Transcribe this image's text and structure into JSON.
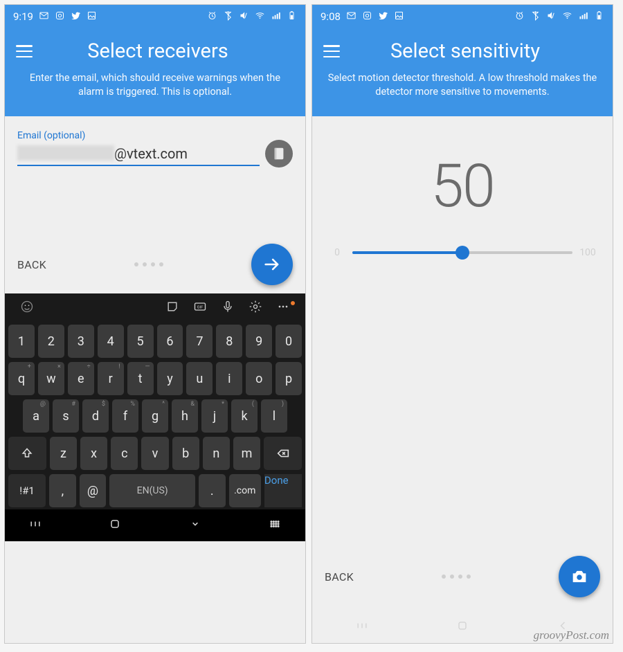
{
  "left": {
    "status": {
      "time": "9:19"
    },
    "header": {
      "title": "Select receivers",
      "subtitle": "Enter the email, which should receive warnings when the alarm is triggered. This is optional."
    },
    "email": {
      "label": "Email (optional)",
      "value_visible": "@vtext.com"
    },
    "actions": {
      "back": "BACK"
    },
    "keyboard": {
      "row_num": [
        "1",
        "2",
        "3",
        "4",
        "5",
        "6",
        "7",
        "8",
        "9",
        "0"
      ],
      "row_q": [
        "q",
        "w",
        "e",
        "r",
        "t",
        "y",
        "u",
        "i",
        "o",
        "p"
      ],
      "row_a": [
        "a",
        "s",
        "d",
        "f",
        "g",
        "h",
        "j",
        "k",
        "l"
      ],
      "row_z": [
        "z",
        "x",
        "c",
        "v",
        "b",
        "n",
        "m"
      ],
      "sym": "!#1",
      "at": "@",
      "space": "EN(US)",
      "dotcom": ".com",
      "done": "Done"
    }
  },
  "right": {
    "status": {
      "time": "9:08"
    },
    "header": {
      "title": "Select sensitivity",
      "subtitle": "Select motion detector threshold. A low threshold makes the detector more sensitive to movements."
    },
    "sensitivity": {
      "value": "50",
      "min": "0",
      "max": "100",
      "percent": 50
    },
    "actions": {
      "back": "BACK"
    }
  },
  "watermark": "groovyPost.com"
}
